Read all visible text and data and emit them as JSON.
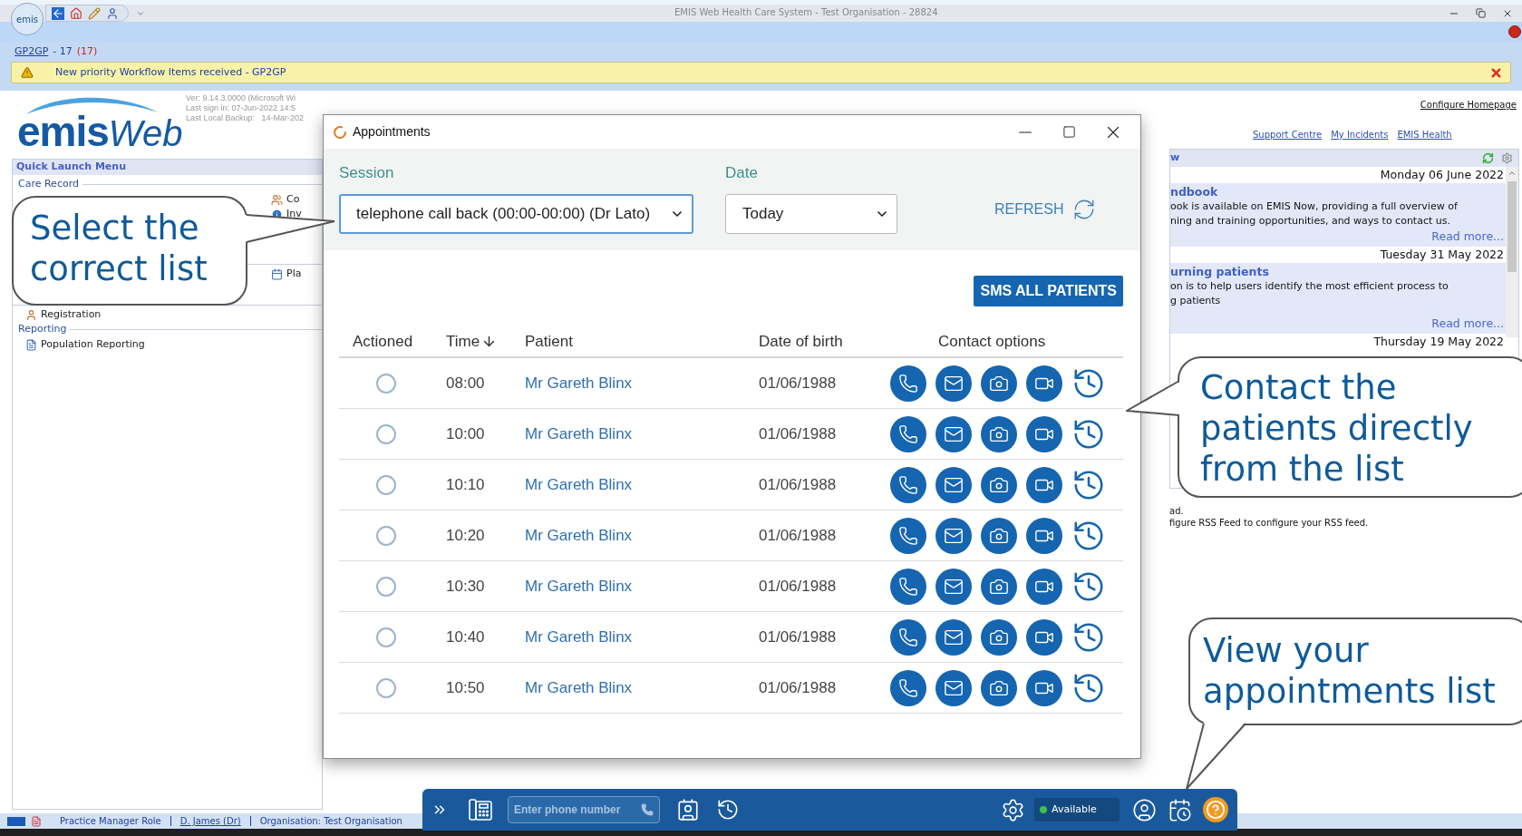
{
  "title_bar": {
    "orb_label": "emis",
    "title": "EMIS Web Health Care System - Test Organisation - 28824"
  },
  "notifications": {
    "link": "GP2GP",
    "count": "- 17",
    "unread": "(17)"
  },
  "alert": {
    "message": "New priority Workflow Items received - GP2GP"
  },
  "logo": {
    "primary": "emis",
    "secondary": "Web"
  },
  "version_info": [
    "Ver: 9.14.3.0000 (Microsoft Wi",
    "Last sign in: 07-Jun-2022 14:5",
    "Last Local Backup:   14-Mar-202"
  ],
  "quick_launch": {
    "title": "Quick Launch Menu",
    "sections": [
      {
        "heading": "Care Record",
        "right_column": [
          {
            "label": "Co",
            "kind": "people"
          },
          {
            "label": "Inv",
            "kind": "info"
          }
        ]
      },
      {
        "right_column": [
          {
            "label": "Pla",
            "kind": "planner"
          }
        ]
      },
      {
        "items": [
          {
            "label": "Registration",
            "kind": "registration"
          }
        ]
      },
      {
        "heading": "Reporting",
        "items": [
          {
            "label": "Population Reporting",
            "kind": "report"
          }
        ]
      }
    ]
  },
  "home_links": {
    "configure": "Configure Homepage",
    "links": [
      "Support Centre",
      "My Incidents",
      "EMIS Health"
    ]
  },
  "news": {
    "header": "w",
    "items": [
      {
        "date": "Monday 06 June 2022",
        "title": "ndbook",
        "lines": [
          "ook is available on EMIS Now, providing a full overview of",
          "ning and training opportunities, and ways to contact us."
        ],
        "read_more": "Read more..."
      },
      {
        "date": "Tuesday 31 May 2022",
        "title": "urning patients",
        "lines": [
          "on is to help users identify the most efficient process to",
          "g patients"
        ],
        "read_more": "Read more..."
      },
      {
        "date": "Thursday 19 May 2022"
      }
    ]
  },
  "rss_message": [
    "ad.",
    "figure RSS Feed to configure your RSS feed."
  ],
  "appointments": {
    "title": "Appointments",
    "session": {
      "label": "Session",
      "value": "telephone call back (00:00-00:00) (Dr Lato)",
      "focused": true
    },
    "date": {
      "label": "Date",
      "value": "Today",
      "focused": false
    },
    "refresh": "REFRESH",
    "sms_button": "SMS ALL PATIENTS",
    "columns": [
      {
        "label": "Actioned",
        "sorted": false
      },
      {
        "label": "Time",
        "sorted": true
      },
      {
        "label": "Patient",
        "sorted": false
      },
      {
        "label": "Date of birth",
        "sorted": false
      },
      {
        "label": "Contact options",
        "sorted": false
      }
    ],
    "rows": [
      {
        "actioned": false,
        "time": "08:00",
        "patient": "Mr Gareth Blinx",
        "dob": "01/06/1988"
      },
      {
        "actioned": false,
        "time": "10:00",
        "patient": "Mr Gareth Blinx",
        "dob": "01/06/1988"
      },
      {
        "actioned": false,
        "time": "10:10",
        "patient": "Mr Gareth Blinx",
        "dob": "01/06/1988"
      },
      {
        "actioned": false,
        "time": "10:20",
        "patient": "Mr Gareth Blinx",
        "dob": "01/06/1988"
      },
      {
        "actioned": false,
        "time": "10:30",
        "patient": "Mr Gareth Blinx",
        "dob": "01/06/1988"
      },
      {
        "actioned": false,
        "time": "10:40",
        "patient": "Mr Gareth Blinx",
        "dob": "01/06/1988"
      },
      {
        "actioned": false,
        "time": "10:50",
        "patient": "Mr Gareth Blinx",
        "dob": "01/06/1988"
      }
    ]
  },
  "toolbar": {
    "phone_placeholder": "Enter phone number",
    "status": {
      "label": "Available",
      "color": "#3ec24b"
    }
  },
  "status_bar": {
    "role": "Practice Manager Role",
    "user": "D. James (Dr)",
    "organisation": "Organisation: Test Organisation"
  },
  "callouts": [
    {
      "text": "Select the correct list"
    },
    {
      "text": "Contact the patients directly from the list"
    },
    {
      "text": "View your appointments list"
    }
  ]
}
